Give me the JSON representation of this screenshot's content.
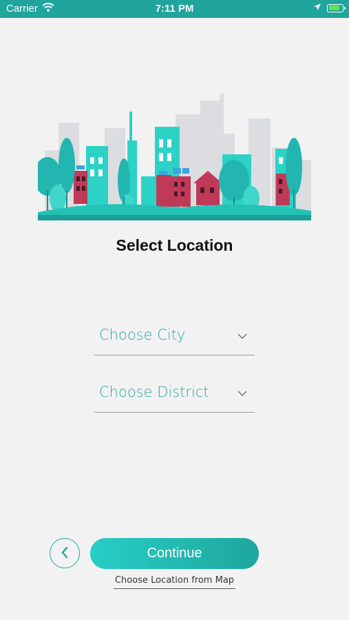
{
  "status_bar": {
    "carrier": "Carrier",
    "time": "7:11 PM",
    "icons": [
      "wifi-icon",
      "location-arrow-icon",
      "battery-charging-icon"
    ],
    "battery_level": 0.85
  },
  "page": {
    "title": "Select Location"
  },
  "form": {
    "city_placeholder": "Choose City",
    "district_placeholder": "Choose District"
  },
  "actions": {
    "back_icon": "chevron-left-icon",
    "continue_label": "Continue",
    "map_link_label": "Choose Location from Map"
  },
  "colors": {
    "accent": "#1fa59c",
    "accent_light": "#27cfc7",
    "building_red": "#c03a57",
    "background": "#f2f2f2"
  }
}
